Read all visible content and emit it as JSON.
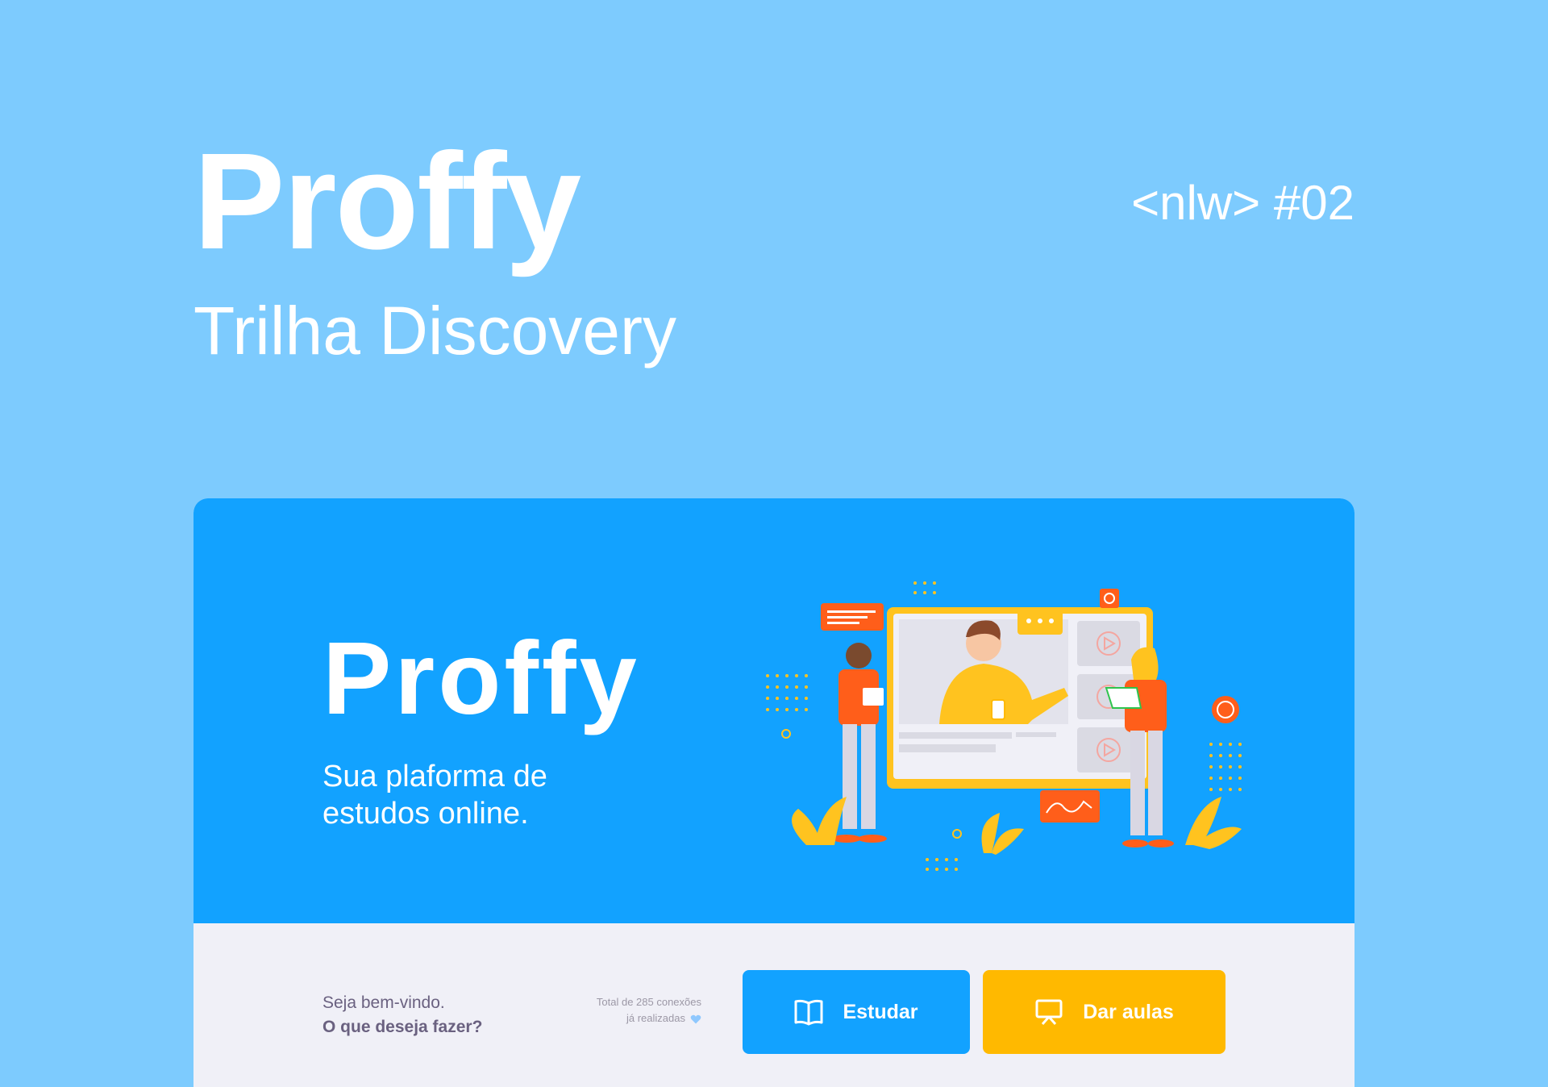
{
  "header": {
    "title": "Proffy",
    "subtitle": "Trilha Discovery",
    "tag": "<nlw> #02"
  },
  "hero": {
    "logo": "Proffy",
    "tagline": "Sua plaforma de estudos online."
  },
  "landing": {
    "welcome": "Seja bem-vindo.",
    "question": "O que deseja fazer?",
    "connections_line1": "Total de 285 conexões",
    "connections_line2": "já realizadas",
    "study_label": "Estudar",
    "teach_label": "Dar aulas"
  },
  "colors": {
    "background": "#7DCBFE",
    "hero": "#12A2FF",
    "panel": "#F0F0F7",
    "primary_button": "#12A2FF",
    "secondary_button": "#FFB900",
    "text": "#6A6180"
  },
  "icons": {
    "study": "book-open-icon",
    "teach": "presentation-icon",
    "connections": "heart-icon"
  }
}
